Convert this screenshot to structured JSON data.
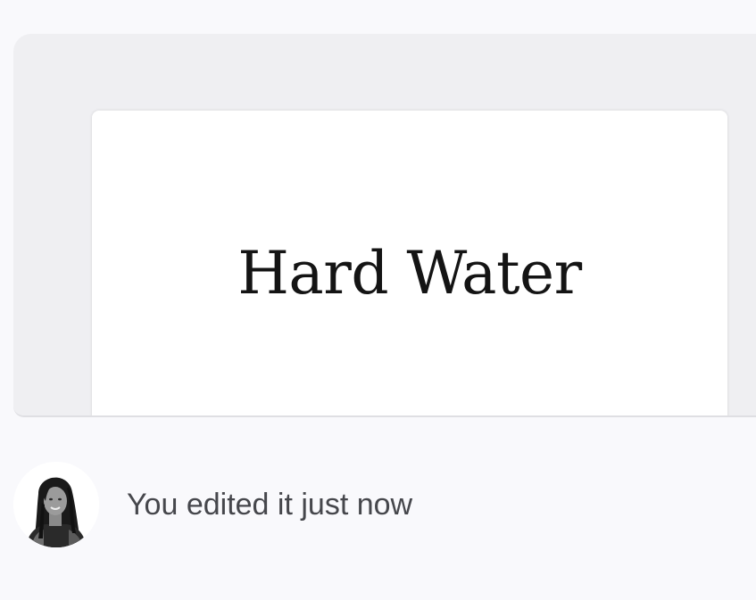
{
  "document": {
    "title": "Hard Water"
  },
  "activity": {
    "text": "You edited it just now",
    "avatar_icon": "user-avatar-photo"
  },
  "colors": {
    "page_background": "#f9f9fc",
    "card_background": "#efeff2",
    "thumbnail_background": "#ffffff",
    "title_text": "#141414",
    "activity_text": "#46474c"
  }
}
